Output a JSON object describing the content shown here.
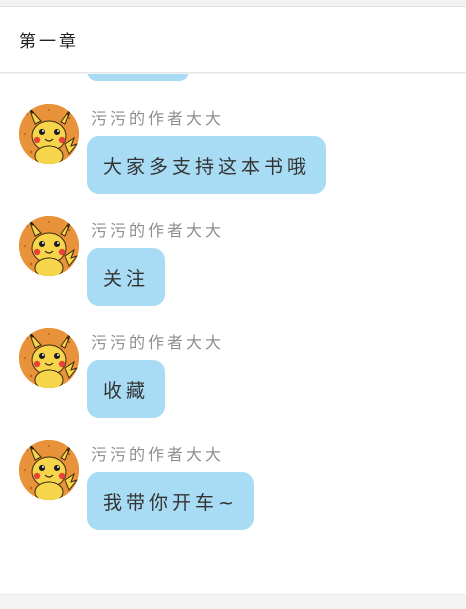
{
  "header": {
    "title": "第一章"
  },
  "messages": [
    {
      "author": "污污的作者大大",
      "text": "大家多支持这本书哦"
    },
    {
      "author": "污污的作者大大",
      "text": "关注"
    },
    {
      "author": "污污的作者大大",
      "text": "收藏"
    },
    {
      "author": "污污的作者大大",
      "text": "我带你开车~"
    }
  ],
  "icons": {
    "avatar": "pikachu-avatar-icon"
  },
  "colors": {
    "bubble": "#a8dcf5",
    "avatar_bg": "#e8923a",
    "author_text": "#8e8e8e",
    "message_text": "#333333"
  }
}
